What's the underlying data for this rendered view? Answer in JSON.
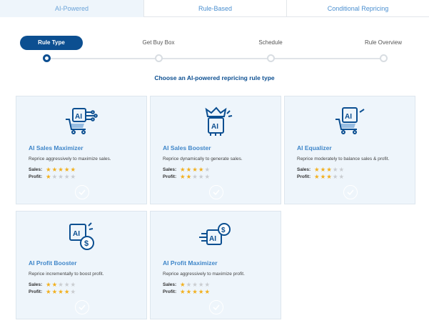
{
  "tabs": [
    {
      "label": "AI-Powered",
      "active": true
    },
    {
      "label": "Rule-Based",
      "active": false
    },
    {
      "label": "Conditional Repricing",
      "active": false
    }
  ],
  "steps": [
    {
      "label": "Rule Type",
      "active": true
    },
    {
      "label": "Get Buy Box",
      "active": false
    },
    {
      "label": "Schedule",
      "active": false
    },
    {
      "label": "Rule Overview",
      "active": false
    }
  ],
  "subtitle": "Choose an AI-powered repricing rule type",
  "sales_label": "Sales:",
  "profit_label": "Profit:",
  "colors": {
    "brand": "#0c4f91",
    "accent": "#3f86c9",
    "card_bg": "#eef5fb",
    "star_on": "#f2b01e",
    "star_off": "#c9ccd0"
  },
  "cards": [
    {
      "title": "AI Sales Maximizer",
      "description": "Reprice aggressively to maximize sales.",
      "sales": 5,
      "profit": 1,
      "icon": "ai-cart-circuit-icon"
    },
    {
      "title": "AI Sales Booster",
      "description": "Reprice dynamically to generate sales.",
      "sales": 4,
      "profit": 2,
      "icon": "ai-crown-chip-icon"
    },
    {
      "title": "AI Equalizer",
      "description": "Reprice moderately to balance sales & profit.",
      "sales": 3,
      "profit": 3,
      "icon": "ai-cart-chip-icon"
    },
    {
      "title": "AI Profit Booster",
      "description": "Reprice incrementally to boost profit.",
      "sales": 2,
      "profit": 4,
      "icon": "ai-chip-dollar-icon"
    },
    {
      "title": "AI Profit Maximizer",
      "description": "Reprice aggressively to maximize profit.",
      "sales": 1,
      "profit": 5,
      "icon": "ai-circuit-dollar-icon"
    }
  ]
}
